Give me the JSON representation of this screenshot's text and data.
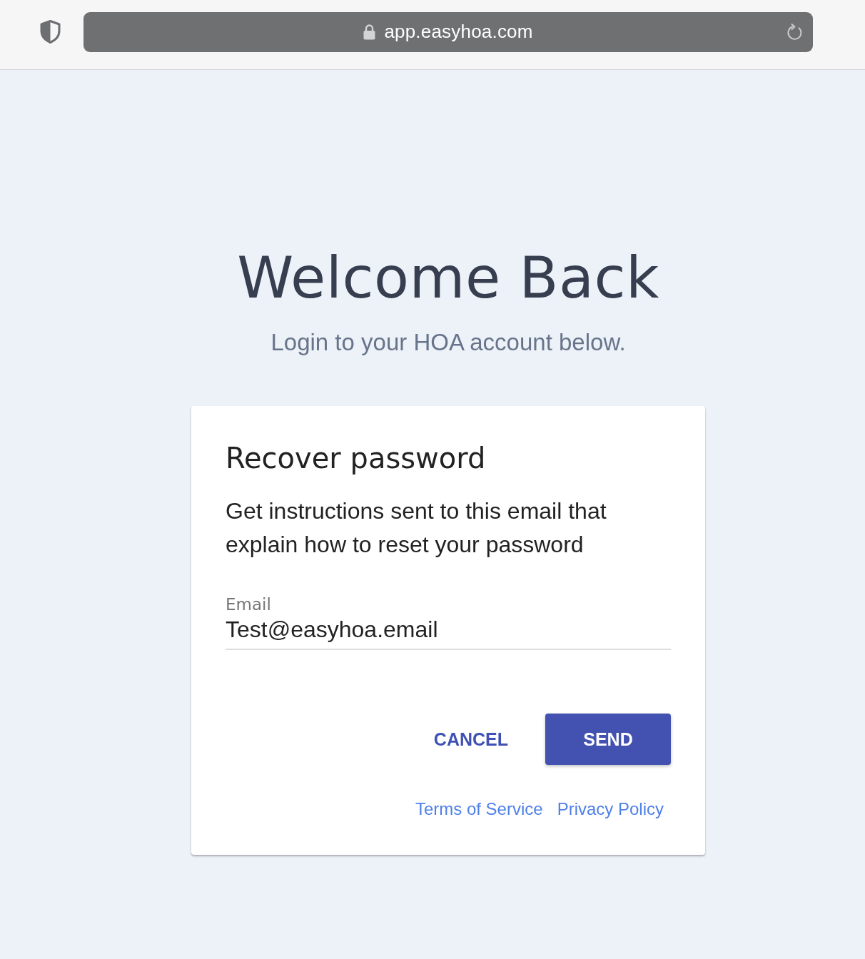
{
  "browser": {
    "url": "app.easyhoa.com",
    "secure": true
  },
  "header": {
    "title": "Welcome Back",
    "subtitle": "Login to your HOA account below."
  },
  "dialog": {
    "title": "Recover password",
    "description": "Get instructions sent to this email that explain how to reset your password",
    "email_field": {
      "label": "Email",
      "value": "Test@easyhoa.email"
    },
    "buttons": [
      {
        "label": "CANCEL",
        "kind": "text"
      },
      {
        "label": "SEND",
        "kind": "primary"
      }
    ],
    "links": [
      "Terms of Service",
      "Privacy Policy"
    ]
  }
}
